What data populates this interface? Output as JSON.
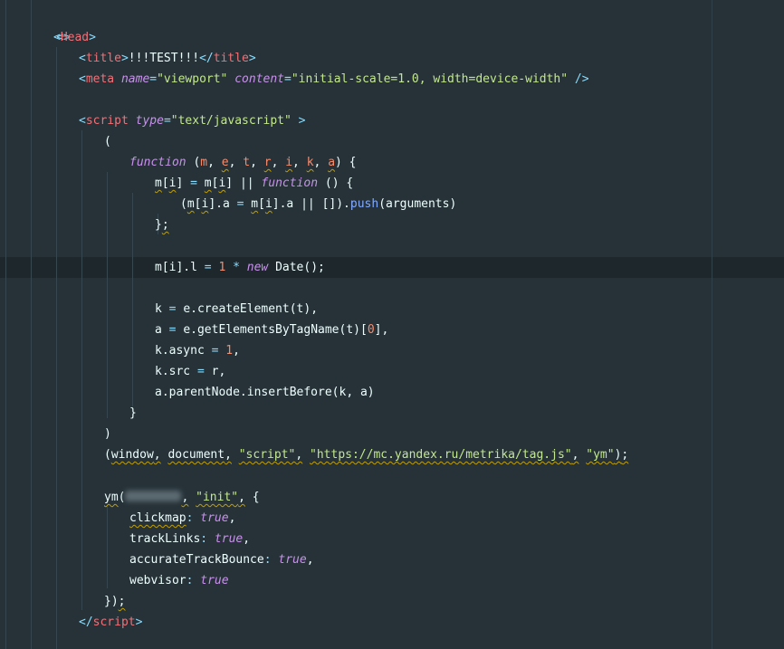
{
  "editor": {
    "placeholder_value": "",
    "lines": {
      "l0": {
        "open": "<>"
      },
      "l1": {
        "lt": "<",
        "tag": "Head",
        "gt": ">"
      },
      "l2": {
        "lt": "<",
        "tag": "title",
        "gt": ">",
        "text": "!!!TEST!!!",
        "lt2": "</",
        "tag2": "title",
        "gt2": ">"
      },
      "l3": {
        "lt": "<",
        "tag": "meta",
        "attr1": "name",
        "eq1": "=",
        "val1": "\"viewport\"",
        "attr2": "content",
        "eq2": "=",
        "val2": "\"initial-scale=1.0, width=device-width\"",
        "close": "/>"
      },
      "l5": {
        "lt": "<",
        "tag": "script",
        "attr": "type",
        "eq": "=",
        "val": "\"text/javascript\"",
        "gt": ">"
      },
      "l6": {
        "paren": "("
      },
      "l7": {
        "kw": "function",
        "open": "(",
        "p1": "m",
        "p2": "e",
        "p3": "t",
        "p4": "r",
        "p5": "i",
        "p6": "k",
        "p7": "a",
        "comma": ",",
        "close": ")",
        "brace": "{"
      },
      "l8": {
        "m": "m",
        "i": "i",
        "eq": "=",
        "or": "||",
        "kw": "function",
        "parens": "()",
        "brace": "{"
      },
      "l9": {
        "m": "m",
        "i": "i",
        "a": "a",
        "eq": "=",
        "or": "||",
        "arr": "[]",
        "push": "push",
        "args": "arguments"
      },
      "l10": {
        "brace": "}",
        "semi": ";"
      },
      "l12": {
        "pre": "m[i].l",
        "eq": "=",
        "num": "1",
        "mul": "*",
        "kw": "new",
        "date": "Date",
        "rest": "();"
      },
      "l14": {
        "pre": "k",
        "eq": "=",
        "obj": "e.createElement",
        "args": "(t),",
        "argsfull": "(t)",
        "comma": ","
      },
      "l15": {
        "pre": "a",
        "eq": "=",
        "obj": "e.getElementsByTagName",
        "args": "(t)[",
        "num": "0",
        "end": "],",
        "close": "]",
        "comma": ","
      },
      "l16": {
        "pre": "k.async",
        "eq": "=",
        "num": "1",
        "comma": ","
      },
      "l17": {
        "pre": "k.src",
        "eq": "=",
        "val": "r",
        "comma": ","
      },
      "l18": {
        "obj": "a.parentNode.insertBefore",
        "args": "(k, a)"
      },
      "l19": {
        "brace": "}"
      },
      "l20": {
        "paren": ")"
      },
      "l21": {
        "open": "(",
        "w": "window",
        "d": "document",
        "s1": "\"script\"",
        "s2": "\"https://mc.yandex.ru/metrika/tag.js\"",
        "s3": "\"ym\"",
        "comma": ",",
        "close": ")",
        "semi": ";"
      },
      "l23": {
        "fn": "ym",
        "open": "(",
        "comma": ",",
        "str": "\"init\"",
        "brace": "{"
      },
      "l24": {
        "key": "clickmap",
        "colon": ":",
        "val": "true",
        "comma": ","
      },
      "l25": {
        "key": "trackLinks",
        "colon": ":",
        "val": "true",
        "comma": ","
      },
      "l26": {
        "key": "accurateTrackBounce",
        "colon": ":",
        "val": "true",
        "comma": ","
      },
      "l27": {
        "key": "webvisor",
        "colon": ":",
        "val": "true"
      },
      "l28": {
        "brace": "}",
        "close": ")",
        "semi": ";"
      },
      "l29": {
        "lt": "</",
        "tag": "script",
        "gt": ">"
      }
    }
  }
}
